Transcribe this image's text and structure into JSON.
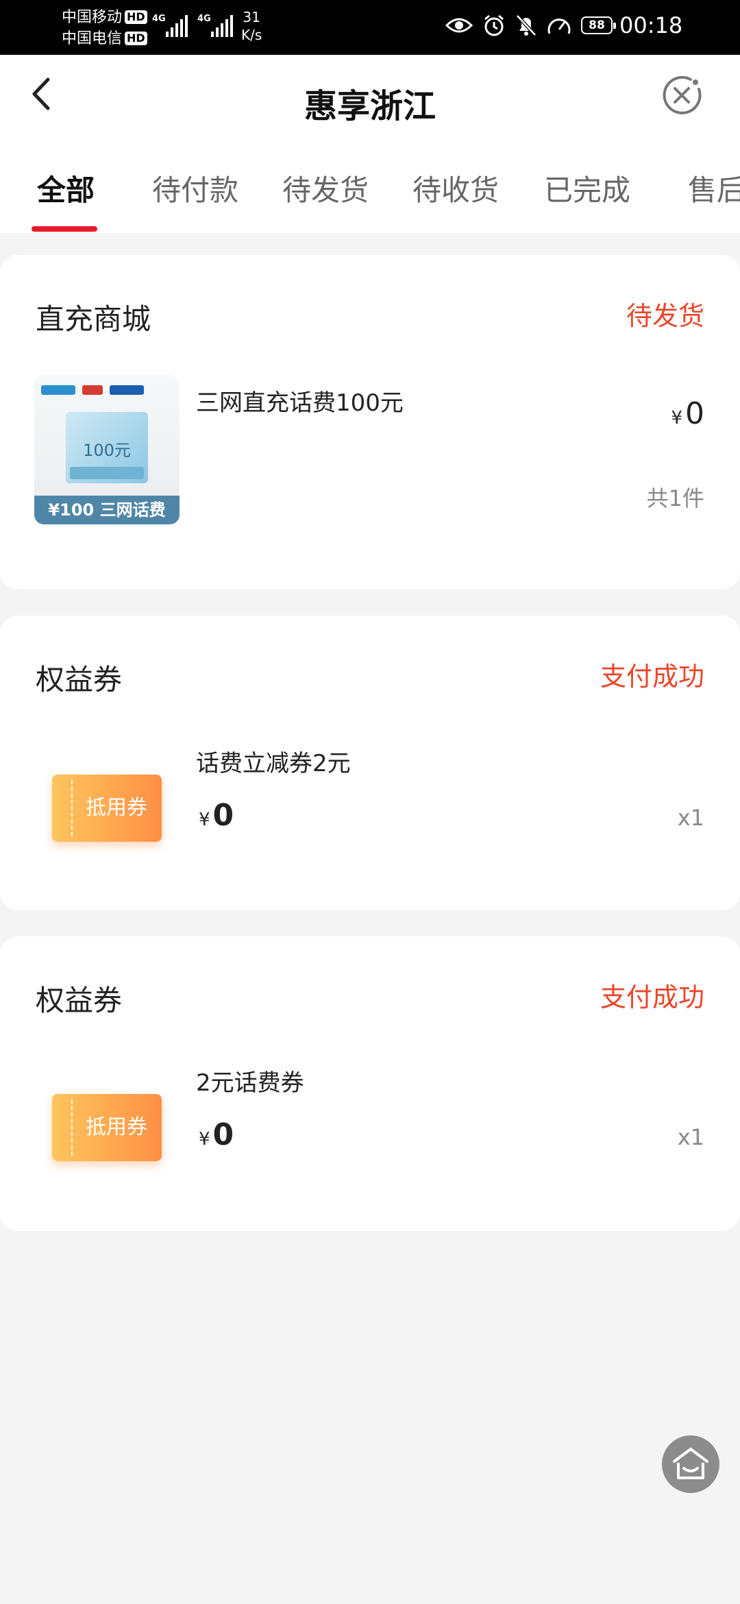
{
  "status_bar": {
    "carrier1": "中国移动",
    "carrier2": "中国电信",
    "hd_badge": "HD",
    "net_gen1": "4G",
    "net_gen2": "4G",
    "speed_value": "31",
    "speed_unit": "K/s",
    "battery": "88",
    "time": "00:18"
  },
  "header": {
    "title": "惠享浙江"
  },
  "tabs": [
    {
      "label": "全部",
      "active": true
    },
    {
      "label": "待付款"
    },
    {
      "label": "待发货"
    },
    {
      "label": "待收货"
    },
    {
      "label": "已完成"
    },
    {
      "label": "售后"
    }
  ],
  "orders": [
    {
      "shop": "直充商城",
      "status": "待发货",
      "item_name": "三网直充话费100元",
      "currency": "¥",
      "price": "0",
      "count": "共1件",
      "thumb": {
        "card_value": "100元",
        "footer": "¥100 三网话费"
      }
    },
    {
      "shop": "权益券",
      "status": "支付成功",
      "item_name": "话费立减券2元",
      "currency": "¥",
      "price": "0",
      "count": "x1",
      "coupon_label": "抵用券"
    },
    {
      "shop": "权益券",
      "status": "支付成功",
      "item_name": "2元话费券",
      "currency": "¥",
      "price": "0",
      "count": "x1",
      "coupon_label": "抵用券"
    }
  ],
  "colors": {
    "accent": "#e8192c",
    "status": "#e8472c",
    "coupon_start": "#ffc55e",
    "coupon_end": "#ff8f45"
  }
}
